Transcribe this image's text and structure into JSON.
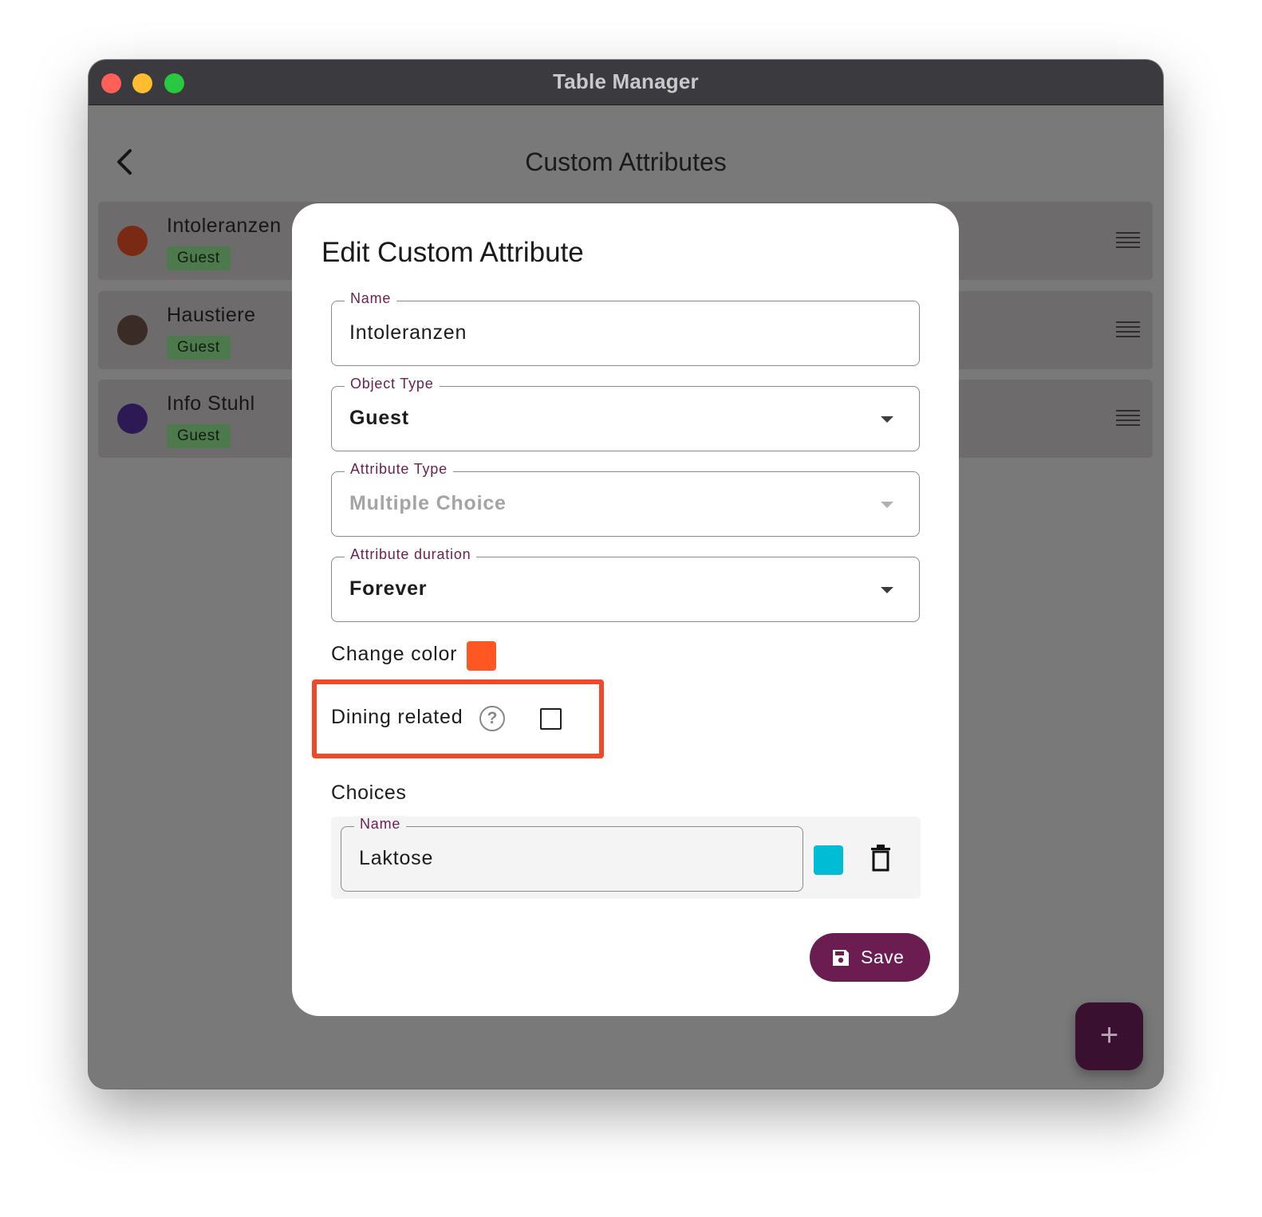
{
  "window": {
    "title": "Table Manager"
  },
  "header": {
    "title": "Custom Attributes",
    "back_icon": "chevron-left-icon"
  },
  "attributes": [
    {
      "name": "Intoleranzen",
      "type": "Guest",
      "color": "#7a2a14"
    },
    {
      "name": "Haustiere",
      "type": "Guest",
      "color": "#3a2b26"
    },
    {
      "name": "Info Stuhl",
      "type": "Guest",
      "color": "#2d1a55"
    }
  ],
  "fab": {
    "label": "+"
  },
  "dialog": {
    "title": "Edit Custom Attribute",
    "name_field": {
      "label": "Name",
      "value": "Intoleranzen"
    },
    "object_type": {
      "label": "Object Type",
      "value": "Guest"
    },
    "attribute_type": {
      "label": "Attribute Type",
      "value": "Multiple Choice",
      "disabled": true
    },
    "duration": {
      "label": "Attribute duration",
      "value": "Forever"
    },
    "change_color": {
      "label": "Change color",
      "color": "#ff5722"
    },
    "dining_related": {
      "label": "Dining related",
      "help_icon": "?",
      "checked": false
    },
    "choices": {
      "heading": "Choices",
      "items": [
        {
          "label": "Name",
          "value": "Laktose",
          "color": "#00bcd4"
        }
      ]
    },
    "save_label": "Save"
  },
  "colors": {
    "accent": "#6b1d52",
    "highlight": "#f0492a",
    "fab": "#3a1030"
  }
}
